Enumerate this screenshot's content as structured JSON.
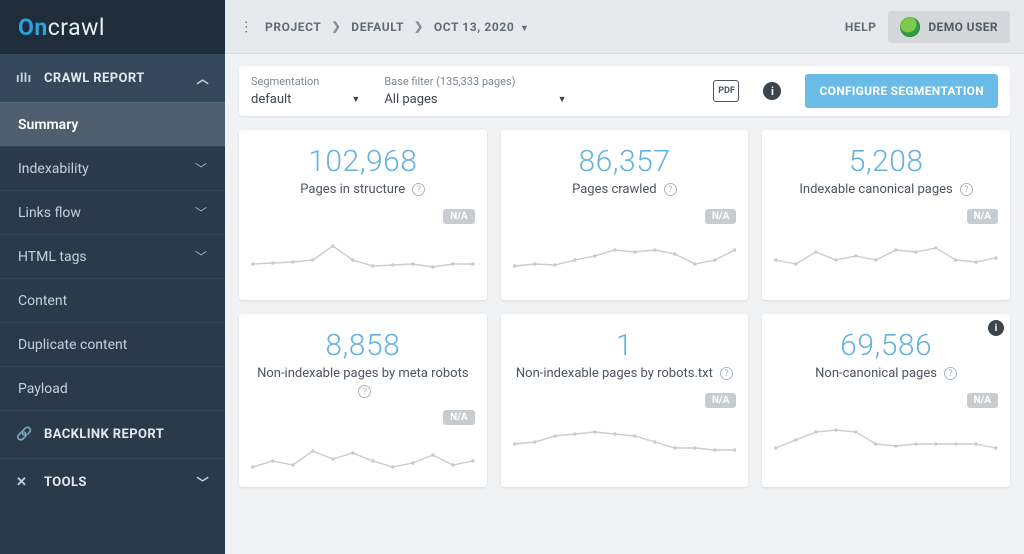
{
  "logo": {
    "part1": "On",
    "part2": "crawl"
  },
  "topbar": {
    "crumbs": [
      "PROJECT",
      "DEFAULT",
      "OCT 13, 2020"
    ],
    "help": "HELP",
    "user": "DEMO USER"
  },
  "filter": {
    "seg_label": "Segmentation",
    "seg_value": "default",
    "base_label": "Base filter (135,333 pages)",
    "base_value": "All pages",
    "pdf_text": "PDF",
    "config_label": "CONFIGURE SEGMENTATION"
  },
  "sidebar": {
    "top_section": "CRAWL REPORT",
    "items": [
      {
        "label": "Summary",
        "expandable": false,
        "active": true
      },
      {
        "label": "Indexability",
        "expandable": true,
        "active": false
      },
      {
        "label": "Links flow",
        "expandable": true,
        "active": false
      },
      {
        "label": "HTML tags",
        "expandable": true,
        "active": false
      },
      {
        "label": "Content",
        "expandable": false,
        "active": false
      },
      {
        "label": "Duplicate content",
        "expandable": false,
        "active": false
      },
      {
        "label": "Payload",
        "expandable": false,
        "active": false
      }
    ],
    "backlink_section": "BACKLINK REPORT",
    "tools_section": "TOOLS"
  },
  "cards": [
    {
      "value": "102,968",
      "label": "Pages in structure",
      "badge": "N/A",
      "spark": "0,34 20,33 40,32 60,30 80,16 100,30 120,36 140,35 160,34 180,37 200,34 220,34"
    },
    {
      "value": "86,357",
      "label": "Pages crawled",
      "badge": "N/A",
      "spark": "0,36 20,34 40,35 60,30 80,26 100,20 120,22 140,20 160,24 180,34 200,30 220,20"
    },
    {
      "value": "5,208",
      "label": "Indexable canonical pages",
      "badge": "N/A",
      "spark": "0,30 20,34 40,22 60,30 80,26 100,30 120,20 140,22 160,18 180,30 200,32 220,28"
    },
    {
      "value": "8,858",
      "label": "Non-indexable pages by meta robots",
      "badge": "N/A",
      "spark": "0,36 20,30 40,34 60,20 80,28 100,22 120,30 140,36 160,32 180,24 200,34 220,30"
    },
    {
      "value": "1",
      "label": "Non-indexable pages by robots.txt",
      "badge": "N/A",
      "spark": "0,30 20,28 40,22 60,20 80,18 100,20 120,22 140,28 160,34 180,34 200,36 220,36"
    },
    {
      "value": "69,586",
      "label": "Non-canonical pages",
      "badge": "N/A",
      "spark": "0,34 20,26 40,18 60,16 80,18 100,30 120,32 140,30 160,30 180,30 200,30 220,34",
      "info": true
    }
  ]
}
